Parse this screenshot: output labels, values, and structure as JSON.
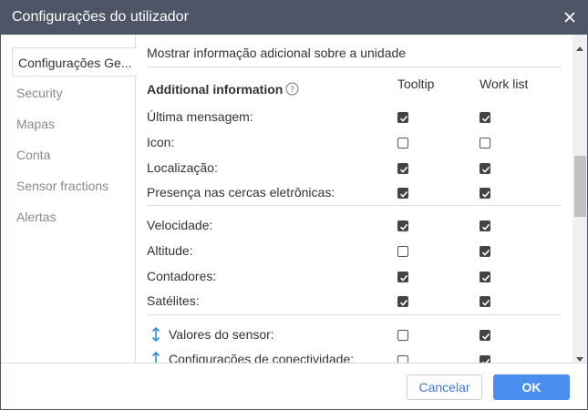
{
  "dialog": {
    "title": "Configurações do utilizador"
  },
  "sidebar": {
    "items": [
      {
        "label": "Configurações Ge...",
        "active": true
      },
      {
        "label": "Security"
      },
      {
        "label": "Mapas"
      },
      {
        "label": "Conta"
      },
      {
        "label": "Sensor fractions"
      },
      {
        "label": "Alertas"
      }
    ]
  },
  "content": {
    "section_title": "Mostrar informação adicional sobre a unidade",
    "header_label": "Additional information",
    "columns": {
      "tooltip": "Tooltip",
      "work_list": "Work list"
    },
    "rows": [
      {
        "label": "Última mensagem:",
        "tooltip": true,
        "work_list": true
      },
      {
        "label": "Icon:",
        "tooltip": false,
        "work_list": false
      },
      {
        "label": "Localização:",
        "tooltip": true,
        "work_list": true
      },
      {
        "label": "Presença nas cercas eletrônicas:",
        "tooltip": true,
        "work_list": true
      },
      {
        "label": "Velocidade:",
        "tooltip": true,
        "work_list": true
      },
      {
        "label": "Altitude:",
        "tooltip": false,
        "work_list": true
      },
      {
        "label": "Contadores:",
        "tooltip": true,
        "work_list": true
      },
      {
        "label": "Satélites:",
        "tooltip": true,
        "work_list": true
      },
      {
        "label": "Valores do sensor:",
        "tooltip": false,
        "work_list": true,
        "icon": "vertical-arrows-icon"
      },
      {
        "label": "Configurações de conectividade:",
        "tooltip": false,
        "work_list": true,
        "icon": "up-arrow-icon"
      }
    ]
  },
  "footer": {
    "cancel_label": "Cancelar",
    "ok_label": "OK"
  },
  "colors": {
    "titlebar": "#4d5566",
    "accent": "#4a8ff0",
    "arrow_icon": "#2b8ee6"
  }
}
